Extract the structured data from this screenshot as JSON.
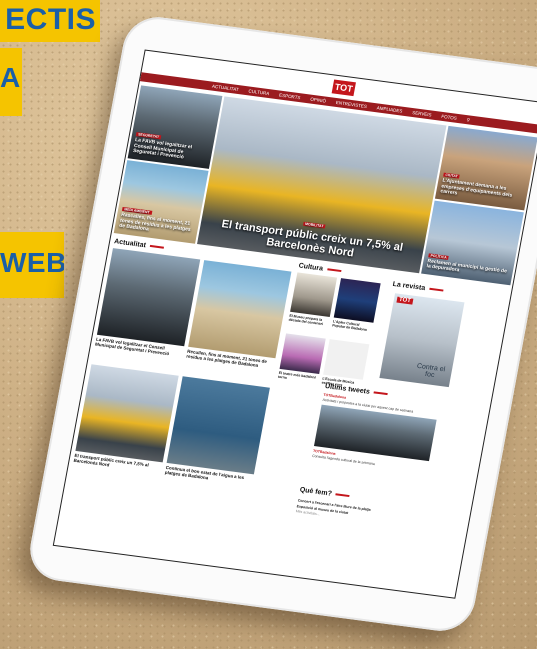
{
  "banners": {
    "top": "ECTIS",
    "mid": "A!",
    "lower": "WEB"
  },
  "site": {
    "logo": "TOT",
    "nav": [
      "ACTUALITAT",
      "CULTURA",
      "ESPORTS",
      "OPINIÓ",
      "ENTREVISTES",
      "AMPLIADES",
      "SERVEIS",
      "FOTOS"
    ]
  },
  "hero": {
    "left_top": "La FAVB vol legalitzar el Consell Municipal de Seguretat i Prevenció",
    "left_bottom": "Rascalles, fins al moment, 21 tones de residus a les platges de Badalona",
    "center": "El transport públic creix un 7,5% al Barcelonès Nord",
    "right_top": "L’Ajuntament demana a les empreses d’equipaments dels carrers",
    "right_bottom": "Reclamen al municipi la gestió de la depuradora"
  },
  "sections": {
    "actualitat": "Actualitat",
    "cultura": "Cultura",
    "revista": "La revista",
    "tweets": "Últims tweets",
    "que_fem": "Què fem?"
  },
  "actualitat": {
    "item1": "La FAVB vol legalitzar el Consell Municipal de Seguretat i Prevenció",
    "item2": "Recullen, fins al moment, 21 tones de residus a les platges de Badalona",
    "item3": "El transport públic creix un 7,5% al Barcelonès Nord",
    "item4": "Continua el bon estat de l’aigua a les platges de Badalona"
  },
  "cultura": {
    "item1": "El Museu prepara la dècada del centenari",
    "item2": "L’Aplec Cultural Popular de Badalona",
    "item3": "El teatre més badaloní torna",
    "item4": "L’Escola de Música estrena curs"
  },
  "revista": {
    "cover_text": "Contra el foc"
  },
  "tweets": {
    "account": "TOTBadalona",
    "text1": "Activitats i propostes a la ciutat per aquest cap de setmana",
    "text2": "Consulta l'agenda cultural de la setmana"
  },
  "que_fem": {
    "line1": "Concert a l'escenari a l'aire lliure de la platja",
    "line2": "Exposició al museu de la ciutat",
    "line3": "Més activitats..."
  }
}
